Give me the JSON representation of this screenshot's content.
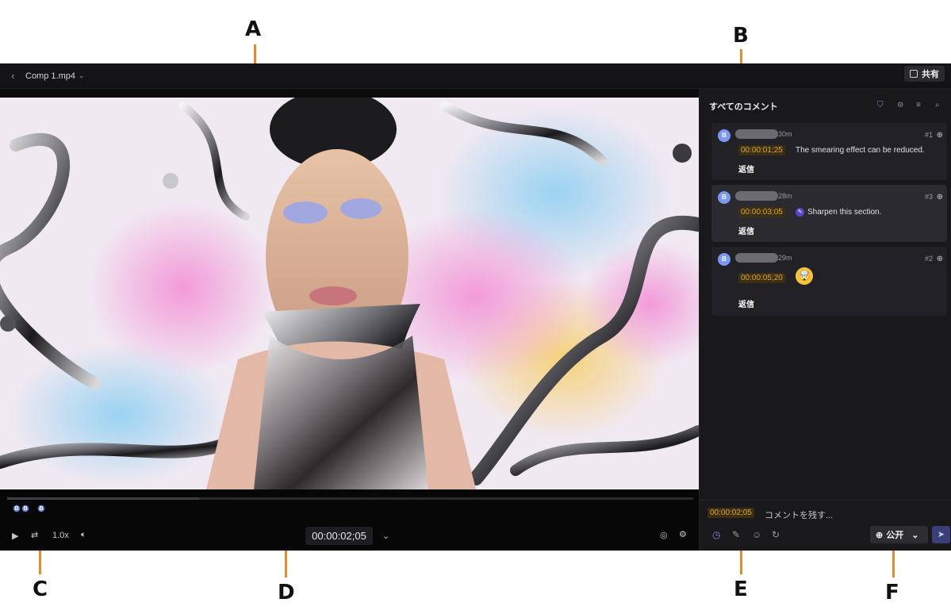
{
  "callouts": [
    "A",
    "B",
    "C",
    "D",
    "E",
    "F"
  ],
  "topbar": {
    "back_icon": "chevron-left-icon",
    "file_name": "Comp 1.mp4",
    "share_label": "共有"
  },
  "timeline": {
    "play_icon": "play-icon",
    "loop_icon": "loop-icon",
    "speed": "1.0x",
    "volume_icon": "volume-icon",
    "timecode": "00:00:02;05",
    "progress_fraction": 0.28,
    "markers": [
      "B",
      "B",
      "B"
    ]
  },
  "panel": {
    "title": "すべてのコメント",
    "comments": [
      {
        "avatar": "B",
        "ago": "30m",
        "number": "#1",
        "timestamp": "00:00:01;25",
        "text": "The smearing effect can be reduced.",
        "reply": "返信"
      },
      {
        "avatar": "B",
        "ago": "28m",
        "number": "#3",
        "timestamp": "00:00:03;05",
        "text": "Sharpen this section.",
        "reply": "返信"
      },
      {
        "avatar": "B",
        "ago": "29m",
        "number": "#2",
        "timestamp": "00:00:05;20",
        "text": "🤯",
        "reply": "返信"
      }
    ],
    "composer": {
      "timestamp": "00:00:02;05",
      "placeholder": "コメントを残す...",
      "visibility": "公开"
    }
  },
  "colors": {
    "accent": "#6a86f5",
    "timestamp": "#e0a33a",
    "callout": "#e38a2e"
  }
}
